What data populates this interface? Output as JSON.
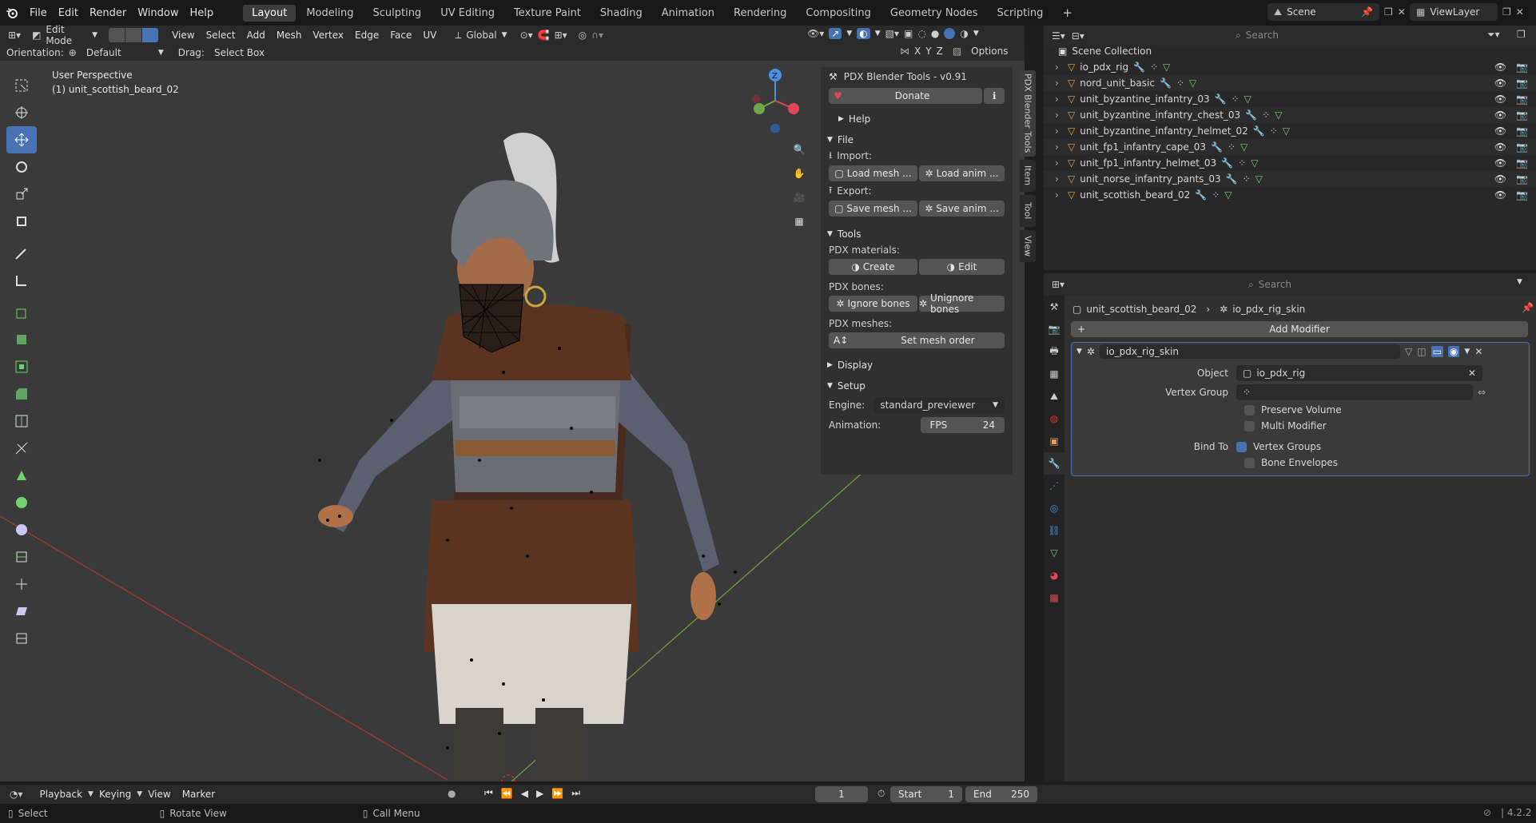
{
  "app_menu": [
    "File",
    "Edit",
    "Render",
    "Window",
    "Help"
  ],
  "workspaces": [
    "Layout",
    "Modeling",
    "Sculpting",
    "UV Editing",
    "Texture Paint",
    "Shading",
    "Animation",
    "Rendering",
    "Compositing",
    "Geometry Nodes",
    "Scripting"
  ],
  "active_workspace": "Layout",
  "scene": {
    "label": "Scene",
    "view_layer": "ViewLayer"
  },
  "search_placeholder": "Search",
  "viewport_header": {
    "mode": "Edit Mode",
    "menus": [
      "View",
      "Select",
      "Add",
      "Mesh",
      "Vertex",
      "Edge",
      "Face",
      "UV"
    ],
    "transform_orientation": "Global",
    "orientation_label": "Orientation:",
    "orientation_value": "Default",
    "drag_label": "Drag:",
    "drag_value": "Select Box",
    "axes": [
      "X",
      "Y",
      "Z"
    ],
    "options": "Options"
  },
  "viewport_overlay": {
    "view_name": "User Perspective",
    "object_name": "(1) unit_scottish_beard_02"
  },
  "gizmo": {
    "z": "Z"
  },
  "pdx_panel": {
    "title": "PDX Blender Tools - v0.91",
    "donate": "Donate",
    "help": "Help",
    "file": "File",
    "import_label": "Import:",
    "load_mesh": "Load mesh ...",
    "load_anim": "Load anim ...",
    "export_label": "Export:",
    "save_mesh": "Save mesh ...",
    "save_anim": "Save anim ...",
    "tools": "Tools",
    "materials_label": "PDX materials:",
    "create": "Create",
    "edit": "Edit",
    "bones_label": "PDX bones:",
    "ignore_bones": "Ignore bones",
    "unignore_bones": "Unignore bones",
    "meshes_label": "PDX meshes:",
    "set_mesh_order": "Set mesh order",
    "display": "Display",
    "setup": "Setup",
    "engine_label": "Engine:",
    "engine_value": "standard_previewer",
    "animation_label": "Animation:",
    "fps_label": "FPS",
    "fps_value": "24"
  },
  "side_tabs": [
    "PDX Blender Tools",
    "Item",
    "Tool",
    "View"
  ],
  "outliner": {
    "root": "Scene Collection",
    "items": [
      {
        "name": "io_pdx_rig"
      },
      {
        "name": "nord_unit_basic"
      },
      {
        "name": "unit_byzantine_infantry_03"
      },
      {
        "name": "unit_byzantine_infantry_chest_03"
      },
      {
        "name": "unit_byzantine_infantry_helmet_02"
      },
      {
        "name": "unit_fp1_infantry_cape_03"
      },
      {
        "name": "unit_fp1_infantry_helmet_03"
      },
      {
        "name": "unit_norse_infantry_pants_03"
      },
      {
        "name": "unit_scottish_beard_02"
      }
    ]
  },
  "properties": {
    "breadcrumb_object": "unit_scottish_beard_02",
    "breadcrumb_modifier": "io_pdx_rig_skin",
    "add_modifier": "Add Modifier",
    "modifier_name": "io_pdx_rig_skin",
    "object_label": "Object",
    "object_value": "io_pdx_rig",
    "vertex_group_label": "Vertex Group",
    "preserve_volume": "Preserve Volume",
    "multi_modifier": "Multi Modifier",
    "bind_to_label": "Bind To",
    "vertex_groups": "Vertex Groups",
    "bone_envelopes": "Bone Envelopes"
  },
  "timeline": {
    "menus": [
      "Playback",
      "Keying",
      "View",
      "Marker"
    ],
    "current_frame": "1",
    "start_label": "Start",
    "start_value": "1",
    "end_label": "End",
    "end_value": "250"
  },
  "statusbar": {
    "select": "Select",
    "rotate": "Rotate View",
    "menu": "Call Menu",
    "version": "4.2.2"
  },
  "colors": {
    "accent": "#4772b3",
    "object_orange": "#e8a05a",
    "mesh_green": "#6fd36f",
    "donate_red": "#e0455a",
    "axis_x": "#e0455a",
    "axis_y": "#6ea84a",
    "axis_z": "#4a8fe0"
  }
}
